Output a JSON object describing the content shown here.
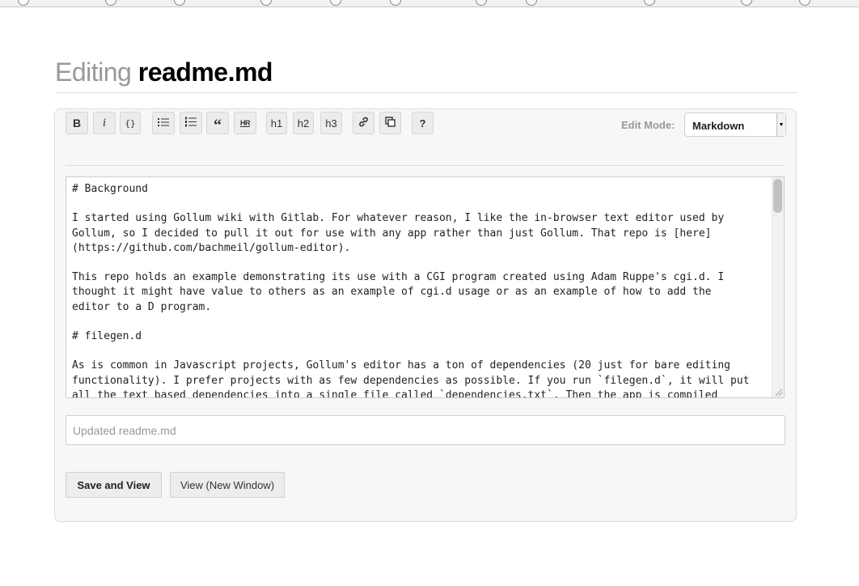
{
  "header": {
    "title_prefix": "Editing",
    "filename": "readme.md"
  },
  "toolbar": {
    "buttons": [
      {
        "id": "bold",
        "glyph": "B",
        "icon": "bold-icon"
      },
      {
        "id": "italic",
        "glyph": "i",
        "icon": "italic-icon"
      },
      {
        "id": "code",
        "glyph": "{}",
        "icon": "code-icon"
      },
      {
        "id": "ul",
        "glyph": "",
        "icon": "unordered-list-icon"
      },
      {
        "id": "ol",
        "glyph": "",
        "icon": "ordered-list-icon"
      },
      {
        "id": "blockquote",
        "glyph": "“",
        "icon": "blockquote-icon"
      },
      {
        "id": "hr",
        "glyph": "HR",
        "icon": "horizontal-rule-icon"
      },
      {
        "id": "h1",
        "glyph": "h1",
        "icon": "heading-1-icon"
      },
      {
        "id": "h2",
        "glyph": "h2",
        "icon": "heading-2-icon"
      },
      {
        "id": "h3",
        "glyph": "h3",
        "icon": "heading-3-icon"
      },
      {
        "id": "link",
        "glyph": "",
        "icon": "link-icon"
      },
      {
        "id": "image",
        "glyph": "",
        "icon": "image-icon"
      },
      {
        "id": "help",
        "glyph": "?",
        "icon": "help-icon"
      }
    ],
    "edit_mode_label": "Edit Mode:",
    "edit_mode_value": "Markdown"
  },
  "editor": {
    "content": "# Background\n\nI started using Gollum wiki with Gitlab. For whatever reason, I like the in-browser text editor used by\nGollum, so I decided to pull it out for use with any app rather than just Gollum. That repo is [here]\n(https://github.com/bachmeil/gollum-editor).\n\nThis repo holds an example demonstrating its use with a CGI program created using Adam Ruppe's cgi.d. I\nthought it might have value to others as an example of cgi.d usage or as an example of how to add the\neditor to a D program.\n\n# filegen.d\n\nAs is common in Javascript projects, Gollum's editor has a ton of dependencies (20 just for bare editing\nfunctionality). I prefer projects with as few dependencies as possible. If you run `filegen.d`, it will put\nall the text based dependencies into a single file called `dependencies.txt`. Then the app is compiled"
  },
  "commit": {
    "placeholder": "Updated readme.md",
    "value": ""
  },
  "actions": {
    "save_label": "Save and View",
    "view_label": "View (New Window)"
  }
}
